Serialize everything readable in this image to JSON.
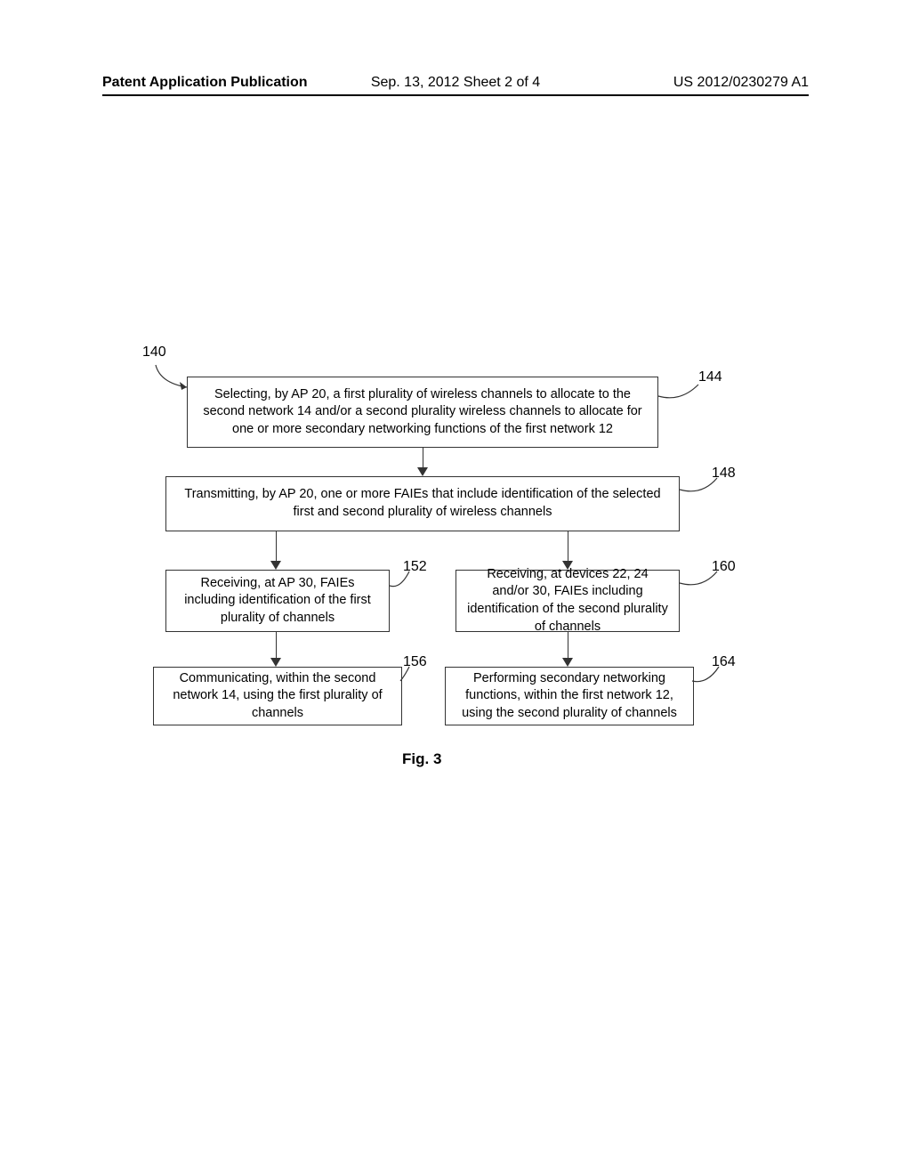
{
  "header": {
    "left": "Patent Application Publication",
    "center": "Sep. 13, 2012   Sheet 2 of 4",
    "right": "US 2012/0230279 A1"
  },
  "diagram": {
    "ref_140": "140",
    "box_144": {
      "text": "Selecting, by AP 20, a first plurality of wireless channels to allocate to the second network 14 and/or a second plurality wireless channels to allocate for one or more secondary networking functions of the first network 12",
      "ref": "144"
    },
    "box_148": {
      "text": "Transmitting, by AP 20, one or more FAIEs that include identification of the selected first and second plurality of wireless channels",
      "ref": "148"
    },
    "box_152": {
      "text": "Receiving, at AP 30, FAIEs including identification of the first plurality of channels",
      "ref": "152"
    },
    "box_156": {
      "text": "Communicating, within the second network 14, using the first plurality of channels",
      "ref": "156"
    },
    "box_160": {
      "text": "Receiving, at devices 22, 24 and/or 30, FAIEs including identification of the second plurality of channels",
      "ref": "160"
    },
    "box_164": {
      "text": "Performing secondary networking functions, within the first network 12, using the second plurality of channels",
      "ref": "164"
    },
    "figure_label": "Fig. 3"
  }
}
